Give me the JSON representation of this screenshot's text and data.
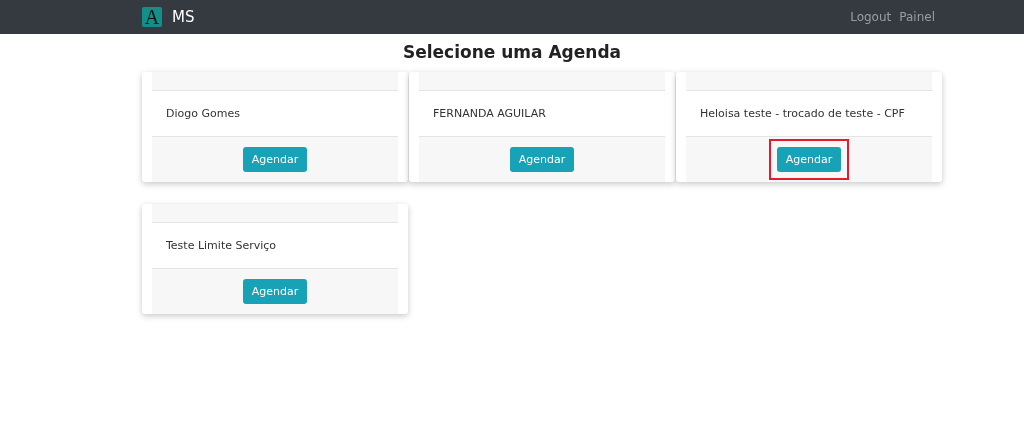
{
  "navbar": {
    "logo_letter": "A",
    "brand": "MS",
    "links": [
      "Logout",
      "Painel"
    ]
  },
  "title": "Selecione uma Agenda",
  "cards": [
    {
      "name": "Diogo Gomes",
      "button": "Agendar",
      "highlighted": false
    },
    {
      "name": "FERNANDA AGUILAR",
      "button": "Agendar",
      "highlighted": false
    },
    {
      "name": "Heloisa teste - trocado de teste - CPF",
      "button": "Agendar",
      "highlighted": true
    },
    {
      "name": "Teste Limite Serviço",
      "button": "Agendar",
      "highlighted": false
    }
  ]
}
